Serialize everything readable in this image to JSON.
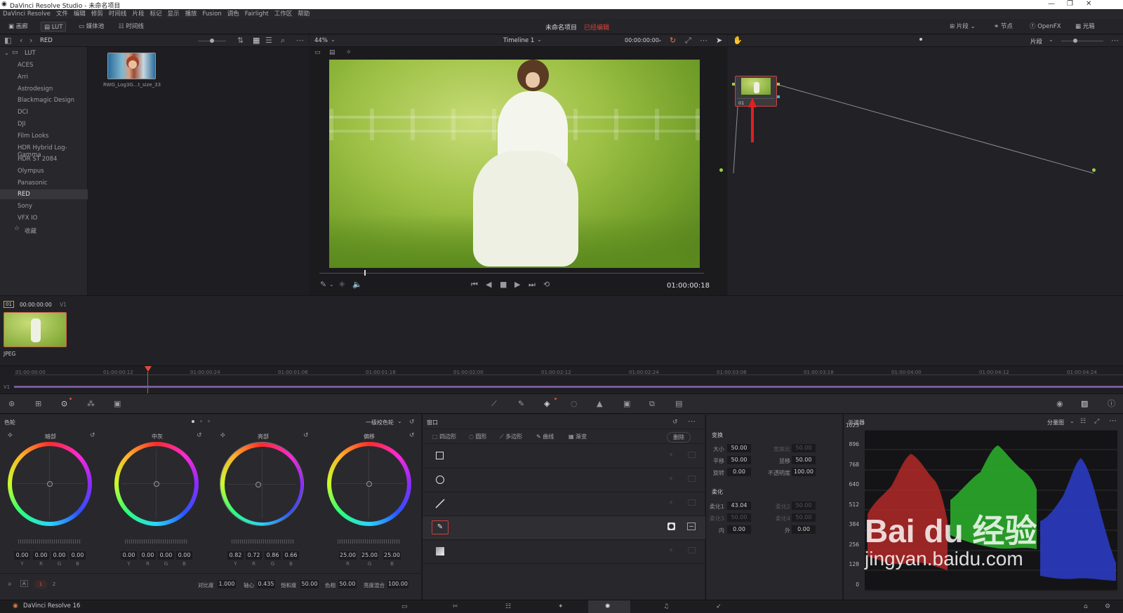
{
  "window": {
    "title": "DaVinci Resolve Studio - 未命名项目",
    "minimize": "—",
    "maximize": "❐",
    "close": "✕"
  },
  "menu": [
    "DaVinci Resolve",
    "文件",
    "编辑",
    "修剪",
    "时间线",
    "片段",
    "标记",
    "显示",
    "播放",
    "Fusion",
    "调色",
    "Fairlight",
    "工作区",
    "帮助"
  ],
  "toolbar": {
    "gallery": "画廊",
    "lut": "LUT",
    "media_pool": "媒体池",
    "timelines": "时间线",
    "project_name": "未命名项目",
    "edit_status": "已经编辑",
    "clips": "片段",
    "nodes": "节点",
    "openfx": "OpenFX",
    "lightbox": "光箱"
  },
  "lut_browser": {
    "path": "RED",
    "root": "LUT",
    "folders": [
      "ACES",
      "Arri",
      "Astrodesign",
      "Blackmagic Design",
      "DCI",
      "DJI",
      "Film Looks",
      "HDR Hybrid Log-Gamma",
      "HDR ST 2084",
      "Olympus",
      "Panasonic",
      "RED",
      "Sony",
      "VFX IO"
    ],
    "selected": "RED",
    "favorites": "收藏",
    "thumbnail_label": "RWG_Log3G…t_size_33"
  },
  "viewer": {
    "zoom": "44%",
    "timeline_name": "Timeline 1",
    "timecode_top": "00:00:00:00",
    "timecode": "01:00:00:18"
  },
  "nodes": {
    "mode": "片段",
    "node_label": "01"
  },
  "clips": {
    "index": "01",
    "timecode": "00:00:00:00",
    "track": "V1",
    "format": "JPEG"
  },
  "ruler": {
    "track_label": "V1",
    "ticks": [
      "01:00:00:00",
      "01:00:00:12",
      "01:00:00:24",
      "01:00:01:06",
      "01:00:01:18",
      "01:00:02:00",
      "01:00:02:12",
      "01:00:02:24",
      "01:00:03:06",
      "01:00:03:18",
      "01:00:04:00",
      "01:00:04:12",
      "01:00:04:24"
    ]
  },
  "color_wheels": {
    "title": "色轮",
    "mode": "一级校色轮",
    "wheels": [
      {
        "name": "暗部",
        "values": [
          "0.00",
          "0.00",
          "0.00",
          "0.00"
        ],
        "labels": [
          "Y",
          "R",
          "G",
          "B"
        ]
      },
      {
        "name": "中灰",
        "values": [
          "0.00",
          "0.00",
          "0.00",
          "0.00"
        ],
        "labels": [
          "Y",
          "R",
          "G",
          "B"
        ]
      },
      {
        "name": "亮部",
        "values": [
          "0.82",
          "0.72",
          "0.86",
          "0.66"
        ],
        "labels": [
          "Y",
          "R",
          "G",
          "B"
        ]
      },
      {
        "name": "偏移",
        "values": [
          "25.00",
          "25.00",
          "25.00"
        ],
        "labels": [
          "R",
          "G",
          "B"
        ]
      }
    ],
    "footer": {
      "page1": "1",
      "page2": "2",
      "contrast_label": "对比度",
      "contrast": "1.000",
      "pivot_label": "轴心",
      "pivot": "0.435",
      "saturation_label": "饱和度",
      "saturation": "50.00",
      "hue_label": "色相",
      "hue": "50.00",
      "lum_mix_label": "亮度混合",
      "lum_mix": "100.00"
    }
  },
  "window_panel": {
    "title": "窗口",
    "tools": [
      "四边形",
      "圆形",
      "多边形",
      "曲线",
      "渐变"
    ],
    "delete": "删除"
  },
  "transform": {
    "title": "变换",
    "size_label": "大小",
    "size": "50.00",
    "aspect_label": "宽高比",
    "aspect": "50.00",
    "pan_label": "平移",
    "pan": "50.00",
    "tilt_label": "竖移",
    "tilt": "50.00",
    "rotate_label": "旋转",
    "rotate": "0.00",
    "opacity_label": "不透明度",
    "opacity": "100.00",
    "softness_title": "柔化",
    "soft1_label": "柔化1",
    "soft1": "43.04",
    "soft2_label": "柔化2",
    "soft2": "50.00",
    "soft3_label": "柔化3",
    "soft3": "50.00",
    "soft4_label": "柔化4",
    "soft4": "50.00",
    "inside_label": "内",
    "inside": "0.00",
    "outside_label": "外",
    "outside": "0.00"
  },
  "scopes": {
    "title": "示波器",
    "mode": "分量图",
    "labels": [
      "1023",
      "896",
      "768",
      "640",
      "512",
      "384",
      "256",
      "128",
      "0"
    ]
  },
  "watermark": {
    "brand": "Bai du 经验",
    "url": "jingyan.baidu.com"
  },
  "status": {
    "app": "DaVinci Resolve 16"
  }
}
